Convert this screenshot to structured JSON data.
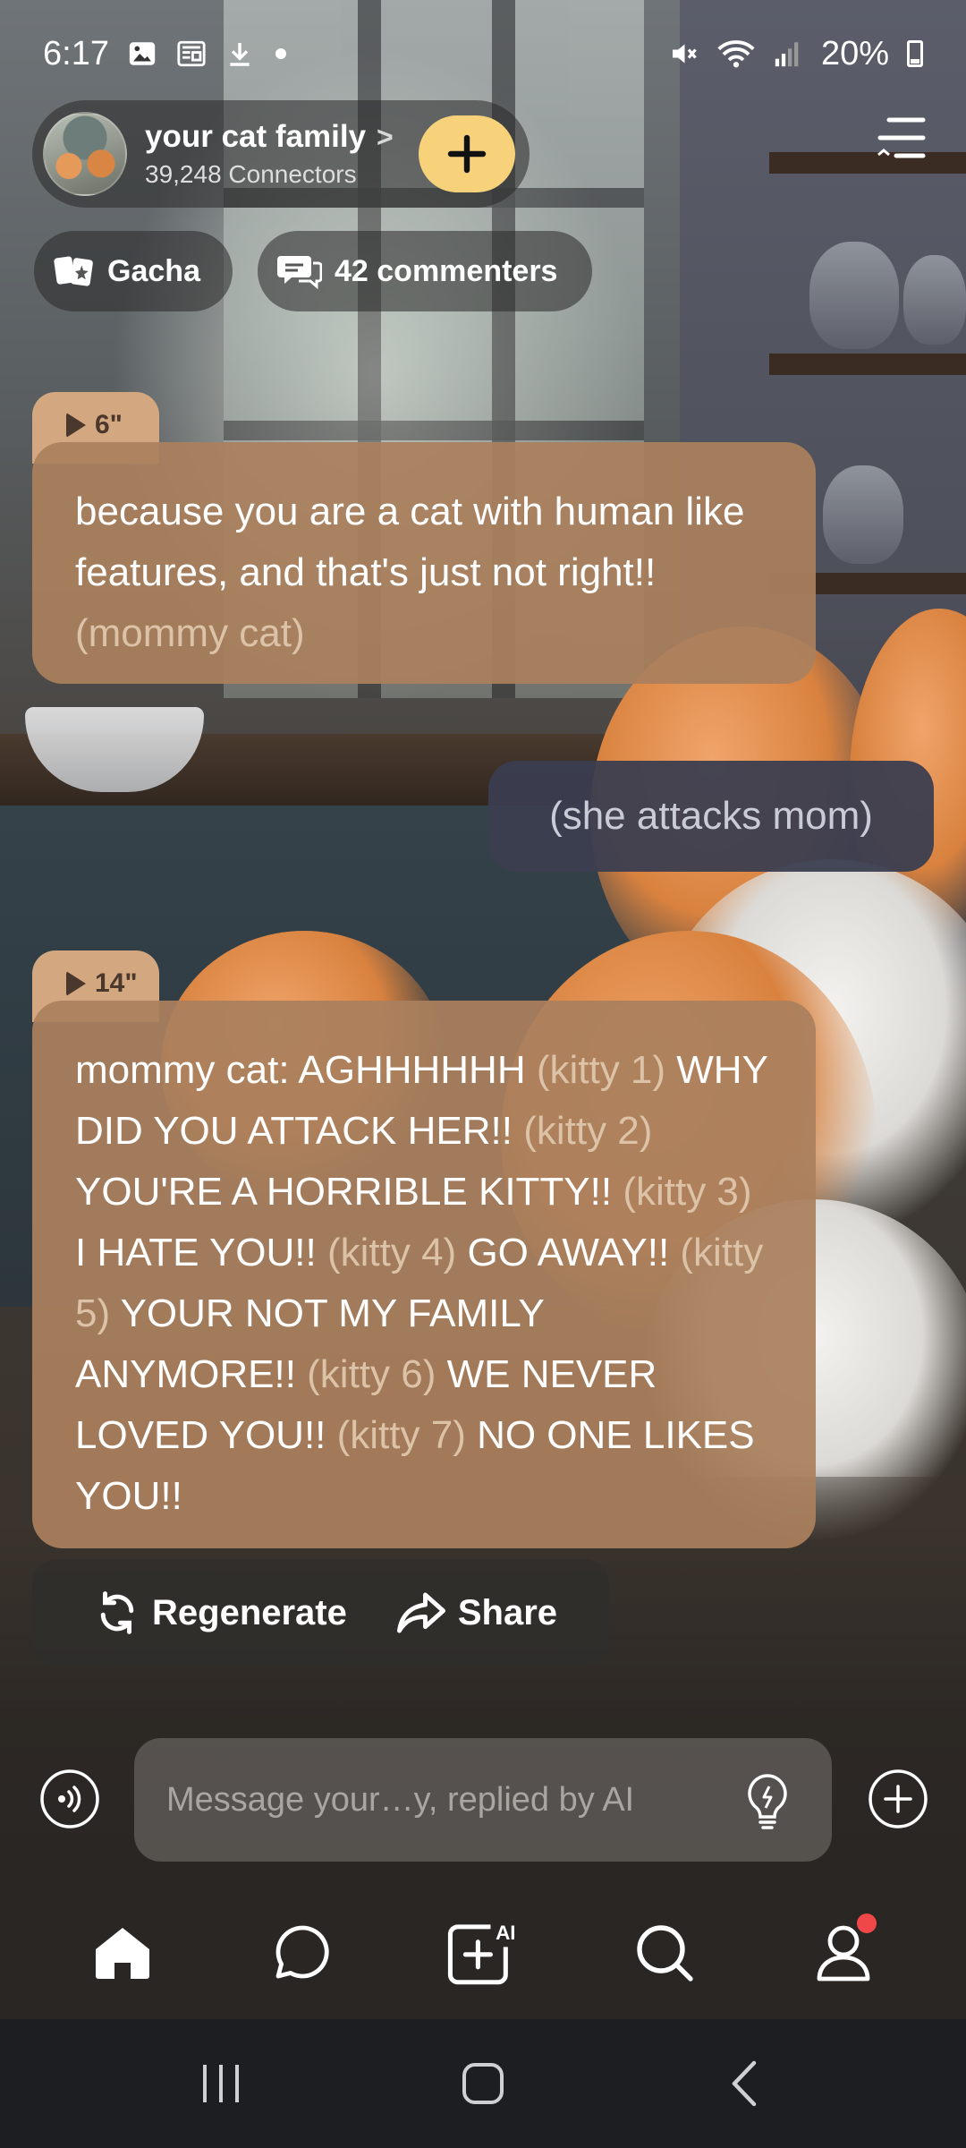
{
  "status_bar": {
    "time": "6:17",
    "battery": "20%",
    "icons": [
      "gallery-icon",
      "news-icon",
      "download-icon",
      "dot-icon",
      "mute-icon",
      "wifi-icon",
      "signal-icon",
      "battery-icon"
    ]
  },
  "header": {
    "community_name": "your cat family",
    "chevron": ">",
    "connectors": "39,248 Connectors",
    "join_icon": "plus-icon",
    "menu_icon": "menu-icon"
  },
  "chips": {
    "gacha": "Gacha",
    "commenters": "42 commenters"
  },
  "messages": [
    {
      "sender": "ai",
      "duration": "6\"",
      "parts": [
        {
          "text": "because you are a cat with human like features, and that's just not right!! ",
          "narr": false
        },
        {
          "text": "(mommy cat)",
          "narr": true
        }
      ]
    },
    {
      "sender": "user",
      "text": "(she attacks mom)"
    },
    {
      "sender": "ai",
      "duration": "14\"",
      "parts": [
        {
          "text": "mommy cat: AGHHHHHH ",
          "narr": false
        },
        {
          "text": "(kitty 1) ",
          "narr": true
        },
        {
          "text": "WHY DID YOU ATTACK HER!! ",
          "narr": false
        },
        {
          "text": "(kitty 2) ",
          "narr": true
        },
        {
          "text": "YOU'RE A HORRIBLE KITTY!! ",
          "narr": false
        },
        {
          "text": "(kitty 3) ",
          "narr": true
        },
        {
          "text": "I HATE YOU!! ",
          "narr": false
        },
        {
          "text": "(kitty 4) ",
          "narr": true
        },
        {
          "text": "GO AWAY!! ",
          "narr": false
        },
        {
          "text": "(kitty 5) ",
          "narr": true
        },
        {
          "text": "YOUR NOT MY FAMILY ANYMORE!! ",
          "narr": false
        },
        {
          "text": "(kitty 6) ",
          "narr": true
        },
        {
          "text": "WE NEVER LOVED YOU!! ",
          "narr": false
        },
        {
          "text": "(kitty 7) ",
          "narr": true
        },
        {
          "text": "NO ONE LIKES YOU!!",
          "narr": false
        }
      ]
    }
  ],
  "actions": {
    "regenerate": "Regenerate",
    "share": "Share"
  },
  "input": {
    "placeholder": "Message your…y, replied by AI",
    "value": ""
  },
  "bottom_nav": {
    "items": [
      "home-icon",
      "chat-icon",
      "create-ai-icon",
      "search-icon",
      "profile-icon"
    ],
    "ai_badge": "AI"
  },
  "colors": {
    "ai_bubble": "#aa805e",
    "user_bubble": "#3a3e50",
    "join_button": "#f7d27a",
    "notification_dot": "#f04848"
  }
}
